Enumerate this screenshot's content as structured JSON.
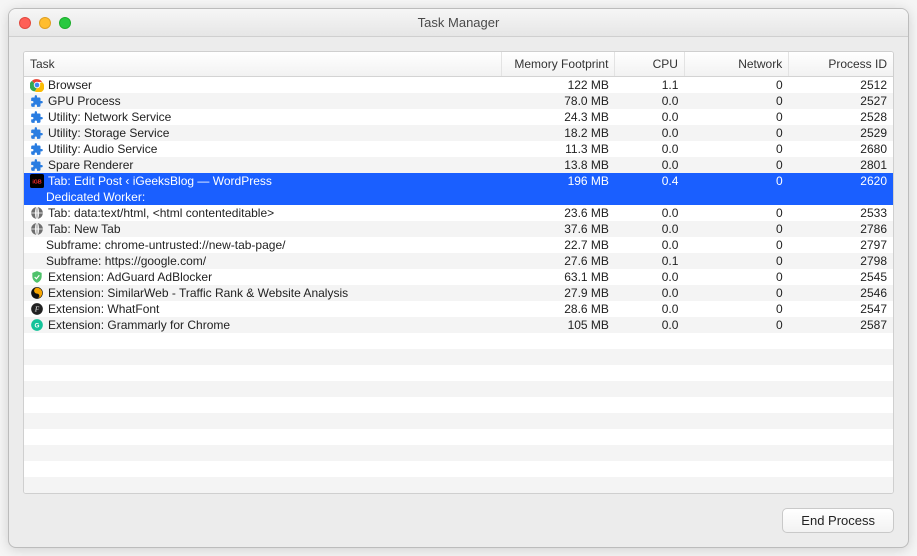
{
  "window": {
    "title": "Task Manager"
  },
  "columns": {
    "task": "Task",
    "memory": "Memory Footprint",
    "cpu": "CPU",
    "network": "Network",
    "pid": "Process ID"
  },
  "rows": [
    {
      "icon": "chrome",
      "indent": 0,
      "selected": false,
      "task": "Browser",
      "memory": "122 MB",
      "cpu": "1.1",
      "network": "0",
      "pid": "2512"
    },
    {
      "icon": "puzzle",
      "indent": 0,
      "selected": false,
      "task": "GPU Process",
      "memory": "78.0 MB",
      "cpu": "0.0",
      "network": "0",
      "pid": "2527"
    },
    {
      "icon": "puzzle",
      "indent": 0,
      "selected": false,
      "task": "Utility: Network Service",
      "memory": "24.3 MB",
      "cpu": "0.0",
      "network": "0",
      "pid": "2528"
    },
    {
      "icon": "puzzle",
      "indent": 0,
      "selected": false,
      "task": "Utility: Storage Service",
      "memory": "18.2 MB",
      "cpu": "0.0",
      "network": "0",
      "pid": "2529"
    },
    {
      "icon": "puzzle",
      "indent": 0,
      "selected": false,
      "task": "Utility: Audio Service",
      "memory": "11.3 MB",
      "cpu": "0.0",
      "network": "0",
      "pid": "2680"
    },
    {
      "icon": "puzzle",
      "indent": 0,
      "selected": false,
      "task": "Spare Renderer",
      "memory": "13.8 MB",
      "cpu": "0.0",
      "network": "0",
      "pid": "2801"
    },
    {
      "icon": "igb",
      "indent": 0,
      "selected": true,
      "task": "Tab: Edit Post ‹ iGeeksBlog — WordPress",
      "memory": "196 MB",
      "cpu": "0.4",
      "network": "0",
      "pid": "2620"
    },
    {
      "icon": "none",
      "indent": 1,
      "selected": true,
      "task": "Dedicated Worker:",
      "memory": "",
      "cpu": "",
      "network": "",
      "pid": ""
    },
    {
      "icon": "globe",
      "indent": 0,
      "selected": false,
      "task": "Tab: data:text/html, <html contenteditable>",
      "memory": "23.6 MB",
      "cpu": "0.0",
      "network": "0",
      "pid": "2533"
    },
    {
      "icon": "globe",
      "indent": 0,
      "selected": false,
      "task": "Tab: New Tab",
      "memory": "37.6 MB",
      "cpu": "0.0",
      "network": "0",
      "pid": "2786"
    },
    {
      "icon": "none",
      "indent": 1,
      "selected": false,
      "task": "Subframe: chrome-untrusted://new-tab-page/",
      "memory": "22.7 MB",
      "cpu": "0.0",
      "network": "0",
      "pid": "2797"
    },
    {
      "icon": "none",
      "indent": 1,
      "selected": false,
      "task": "Subframe: https://google.com/",
      "memory": "27.6 MB",
      "cpu": "0.1",
      "network": "0",
      "pid": "2798"
    },
    {
      "icon": "shield",
      "indent": 0,
      "selected": false,
      "task": "Extension: AdGuard AdBlocker",
      "memory": "63.1 MB",
      "cpu": "0.0",
      "network": "0",
      "pid": "2545"
    },
    {
      "icon": "swirl",
      "indent": 0,
      "selected": false,
      "task": "Extension: SimilarWeb - Traffic Rank & Website Analysis",
      "memory": "27.9 MB",
      "cpu": "0.0",
      "network": "0",
      "pid": "2546"
    },
    {
      "icon": "f",
      "indent": 0,
      "selected": false,
      "task": "Extension: WhatFont",
      "memory": "28.6 MB",
      "cpu": "0.0",
      "network": "0",
      "pid": "2547"
    },
    {
      "icon": "g",
      "indent": 0,
      "selected": false,
      "task": "Extension: Grammarly for Chrome",
      "memory": "105 MB",
      "cpu": "0.0",
      "network": "0",
      "pid": "2587"
    }
  ],
  "fillerRows": 10,
  "footer": {
    "end_process": "End Process"
  }
}
